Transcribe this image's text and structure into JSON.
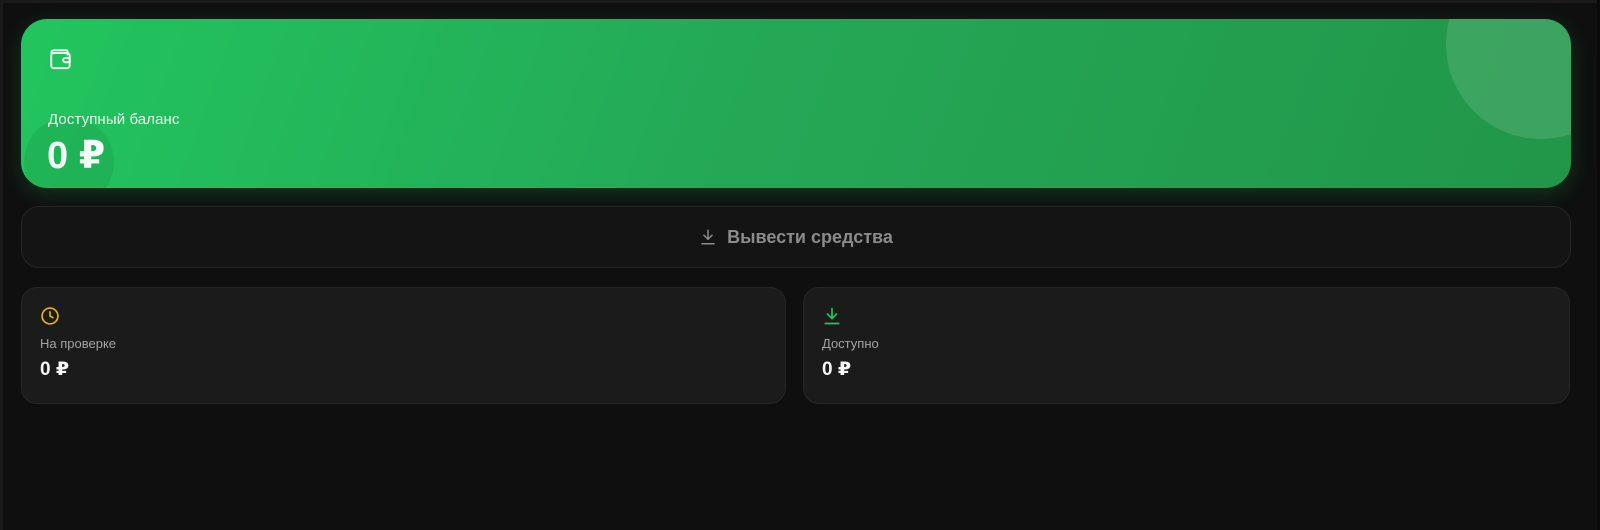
{
  "balance_card": {
    "label": "Доступный баланс",
    "amount": "0 ₽",
    "icon": "wallet-icon",
    "accent_color": "#22c55e"
  },
  "withdraw_button": {
    "label": "Вывести средства",
    "icon": "download-icon"
  },
  "stats": [
    {
      "label": "На проверке",
      "value": "0 ₽",
      "icon": "clock-icon",
      "icon_color": "#eab308"
    },
    {
      "label": "Доступно",
      "value": "0 ₽",
      "icon": "download-icon",
      "icon_color": "#22c55e"
    }
  ]
}
